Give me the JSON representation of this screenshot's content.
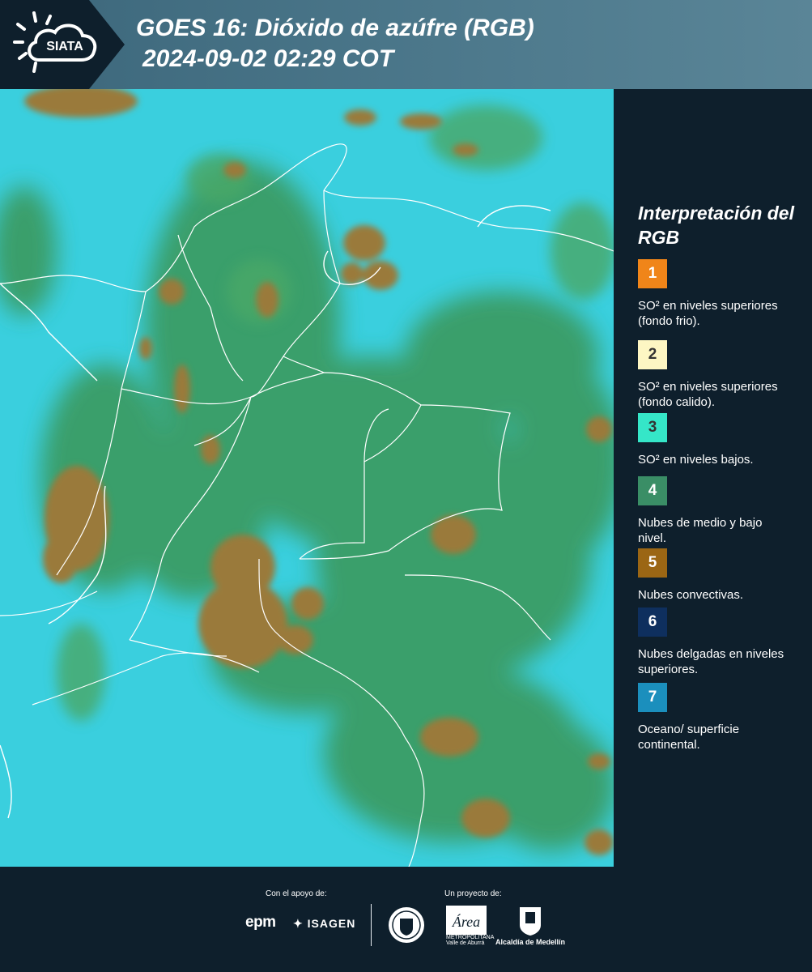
{
  "header": {
    "logo_text": "SIATA",
    "title_line1": "GOES 16: Dióxido de azúfre (RGB)",
    "title_line2": "2024-09-02 02:29 COT"
  },
  "map": {
    "background_color": "#3fd4e0",
    "cloud_colors": {
      "mid_low": "#2e9a5a",
      "convective": "#9a7a3a",
      "ocean": "#3fd4e0"
    }
  },
  "legend": {
    "title": "Interpretación del RGB",
    "items": [
      {
        "number": "1",
        "color": "#f08519",
        "text_color": "#ffffff",
        "label": "SO² en niveles superiores (fondo frio)."
      },
      {
        "number": "2",
        "color": "#fdf6c3",
        "text_color": "#333333",
        "label": "SO² en niveles superiores (fondo calido)."
      },
      {
        "number": "3",
        "color": "#35e6c8",
        "text_color": "#333333",
        "label": "SO² en niveles bajos."
      },
      {
        "number": "4",
        "color": "#3a8e66",
        "text_color": "#ffffff",
        "label": "Nubes de medio y bajo nivel."
      },
      {
        "number": "5",
        "color": "#9b6614",
        "text_color": "#ffffff",
        "label": "Nubes convectivas."
      },
      {
        "number": "6",
        "color": "#0e2f5e",
        "text_color": "#ffffff",
        "label": "Nubes delgadas en niveles superiores."
      },
      {
        "number": "7",
        "color": "#1b8fbd",
        "text_color": "#ffffff",
        "label": "Oceano/ superficie continental."
      }
    ]
  },
  "footer": {
    "support_label": "Con el apoyo de:",
    "project_label": "Un proyecto de:",
    "sponsor1": "epm",
    "sponsor2": "ISAGEN",
    "partner_area": "Área",
    "partner_area_sub": "METROPOLITANA Valle de Aburrá",
    "partner_alcaldia": "Alcaldía de Medellín"
  }
}
